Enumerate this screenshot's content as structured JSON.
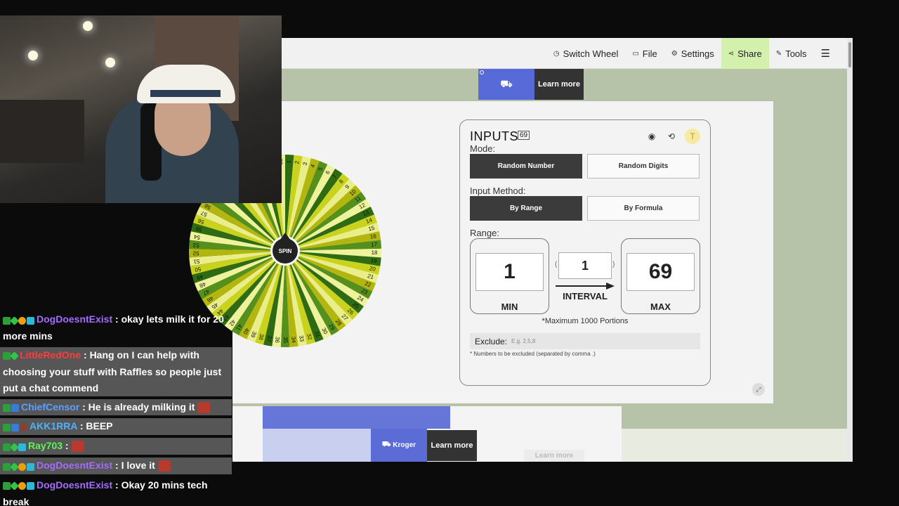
{
  "nav": {
    "switch_wheel": "Switch Wheel",
    "file": "File",
    "settings": "Settings",
    "share": "Share",
    "tools": "Tools"
  },
  "ads": {
    "learn_more_top": "Learn more",
    "learn_more_bottom": "Learn more",
    "learn_more_faded": "Learn more",
    "kroger": "Kroger"
  },
  "wheel": {
    "spin_label": "SPIN",
    "count": 69,
    "colors": [
      "#2f6b12",
      "#c9d31d",
      "#e9ed8a",
      "#b3b60e",
      "#55901c",
      "#eef29b"
    ]
  },
  "inputs": {
    "title": "INPUTS",
    "count": "69",
    "mode_label": "Mode:",
    "mode_options": [
      "Random Number",
      "Random Digits"
    ],
    "method_label": "Input Method:",
    "method_options": [
      "By Range",
      "By Formula"
    ],
    "range_label": "Range:",
    "min_value": "1",
    "min_caption": "MIN",
    "interval_value": "1",
    "interval_caption": "INTERVAL",
    "max_value": "69",
    "max_caption": "MAX",
    "max_note": "*Maximum 1000 Portions",
    "exclude_label": "Exclude:",
    "exclude_placeholder": "E.g. 2,5,8",
    "exclude_note": "* Numbers to be excluded (separated by comma .)",
    "avatar_letter": "T"
  },
  "chat": [
    {
      "user": "DogDoesntExist",
      "text": " : okay lets milk it for 20 more mins"
    },
    {
      "user": "LittleRedOne",
      "text": " : Hang on I can help with choosing your stuff with Raffles so people just put a chat commend"
    },
    {
      "user": "ChiefCensor",
      "text": " : He is already milking it"
    },
    {
      "user": "AKK1RRA",
      "text": " :  BEEP"
    },
    {
      "user": "Ray703",
      "text": " : "
    },
    {
      "user": "DogDoesntExist",
      "text": " : I love it"
    },
    {
      "user": "DogDoesntExist",
      "text": " : Okay 20 mins tech break"
    }
  ]
}
